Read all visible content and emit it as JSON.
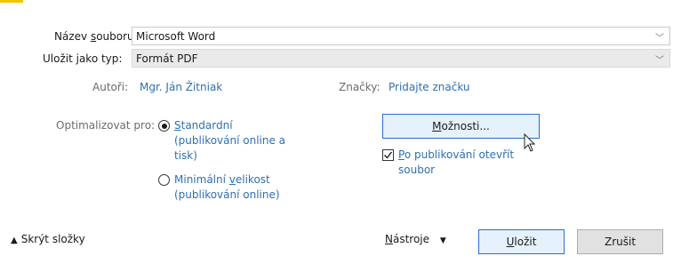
{
  "form": {
    "filename_label_pre": "Název ",
    "filename_label_key": "s",
    "filename_label_post": "ouboru:",
    "filename_value": "Microsoft Word",
    "type_label": "Uložit jako typ:",
    "type_value": "Formát PDF"
  },
  "meta": {
    "authors_label": "Autoři:",
    "authors_value": "Mgr. Ján Žitniak",
    "tags_label": "Značky:",
    "tags_value": "Pridajte značku"
  },
  "optimize": {
    "label": "Optimalizovat pro:",
    "standard_key": "S",
    "standard_rest": "tandardní",
    "standard_line2": "(publikování online a",
    "standard_line3": "tisk)",
    "minimal_pre": "Minimální ",
    "minimal_key": "v",
    "minimal_post": "elikost",
    "minimal_line2": "(publikování online)"
  },
  "options": {
    "button_key": "M",
    "button_rest": "ožnosti...",
    "open_key": "P",
    "open_rest": "o publikování otevřít",
    "open_line2": "soubor",
    "open_checked": true
  },
  "footer": {
    "hide_folders": "Skrýt složky",
    "tools_key": "N",
    "tools_rest": "ástroje",
    "save_key": "U",
    "save_rest": "ložit",
    "cancel": "Zrušit"
  },
  "icons": {
    "dropdown": "chevron-down-icon",
    "collapse": "chevron-up-icon",
    "cursor": "mouse-pointer-icon"
  }
}
